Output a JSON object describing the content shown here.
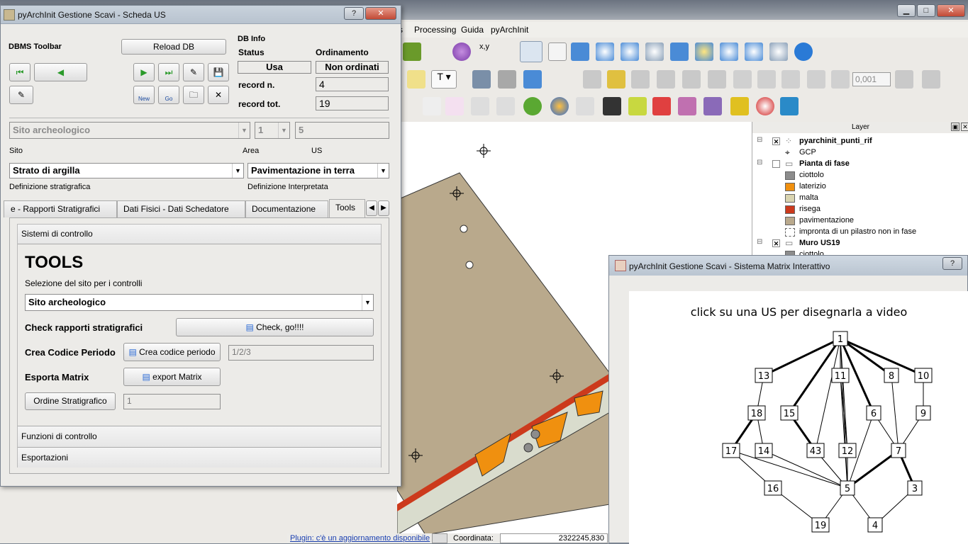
{
  "qgis": {
    "menu": [
      "Processing",
      "Guida",
      "pyArchInit"
    ],
    "scale_value": "0,001",
    "layers_title": "Layer",
    "layers": [
      {
        "name": "pyarchinit_punti_rif",
        "bold": true
      },
      {
        "name": "GCP",
        "bold": false
      },
      {
        "name": "Pianta di fase",
        "bold": true
      },
      {
        "name": "ciottolo",
        "bold": false,
        "color": "#8c8c8c"
      },
      {
        "name": "laterizio",
        "bold": false,
        "color": "#f0900f"
      },
      {
        "name": "malta",
        "bold": false,
        "color": "#d9d4b0"
      },
      {
        "name": "risega",
        "bold": false,
        "color": "#cc3a1c"
      },
      {
        "name": "pavimentazione",
        "bold": false,
        "color": "#b9a98c"
      },
      {
        "name": "impronta di un pilastro non in fase",
        "bold": false,
        "color": "#ffffff"
      },
      {
        "name": "Muro US19",
        "bold": true
      },
      {
        "name": "ciottolo",
        "bold": false,
        "color": "#8c8c8c"
      }
    ],
    "status_plugin": "Plugin: c'è un aggiornamento disponibile",
    "status_coord_label": "Coordinata:",
    "status_coord_value": "2322245,830"
  },
  "scheda": {
    "title": "pyArchInit Gestione Scavi - Scheda US",
    "help_btn": "?",
    "close_btn": "✕",
    "dbms_toolbar": "DBMS Toolbar",
    "reload_db": "Reload DB",
    "db_info": "DB Info",
    "status_label": "Status",
    "ordinamento_label": "Ordinamento",
    "status_value": "Usa",
    "ordinamento_value": "Non ordinati",
    "record_n_label": "record n.",
    "record_n_value": "4",
    "record_tot_label": "record tot.",
    "record_tot_value": "19",
    "new_label": "New",
    "go_label": "Go",
    "sito_value": "Sito archeologico",
    "area_value": "1",
    "us_value": "5",
    "sito_label": "Sito",
    "area_label": "Area",
    "us_label": "US",
    "def_strat_value": "Strato di argilla",
    "def_interp_value": "Pavimentazione in terra",
    "def_strat_label": "Definizione stratigrafica",
    "def_interp_label": "Definizione Interpretata",
    "tabs": [
      "e - Rapporti Stratigrafici",
      "Dati Fisici - Dati Schedatore",
      "Documentazione",
      "Tools"
    ],
    "section_controllo": "Sistemi di controllo",
    "tools_heading": "TOOLS",
    "selezione_label": "Selezione del sito per i controlli",
    "selezione_value": "Sito archeologico",
    "check_label": "Check rapporti stratigrafici",
    "check_btn": "Check, go!!!!",
    "crea_label": "Crea Codice Periodo",
    "crea_btn": "Crea codice periodo",
    "crea_field": "1/2/3",
    "esporta_label": "Esporta Matrix",
    "export_btn": "export Matrix",
    "ordine_btn": "Ordine Stratigrafico",
    "ordine_field": "1",
    "section_funzioni": "Funzioni di controllo",
    "section_esportazioni": "Esportazioni"
  },
  "matrix": {
    "title": "pyArchInit Gestione Scavi - Sistema Matrix Interattivo",
    "help_btn": "?",
    "caption": "click su una US per disegnarla a video",
    "nodes": [
      "1",
      "13",
      "11",
      "8",
      "10",
      "18",
      "15",
      "6",
      "9",
      "17",
      "14",
      "43",
      "12",
      "7",
      "16",
      "5",
      "3",
      "19",
      "4"
    ]
  }
}
